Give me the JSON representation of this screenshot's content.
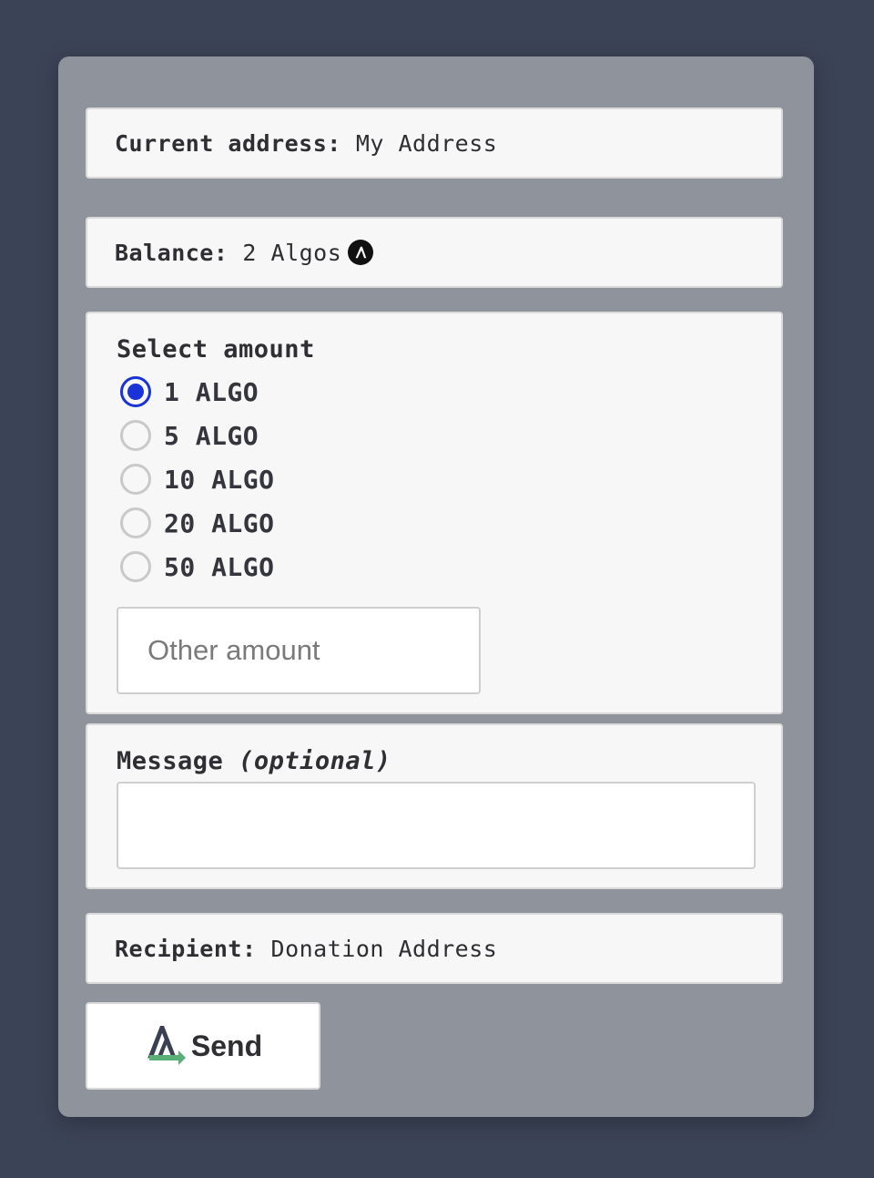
{
  "address": {
    "label": "Current address:",
    "value": "My Address"
  },
  "balance": {
    "label": "Balance:",
    "value": "2 Algos",
    "icon": "algo-coin-icon"
  },
  "amount": {
    "label": "Select amount",
    "options": [
      "1 ALGO",
      "5 ALGO",
      "10 ALGO",
      "20 ALGO",
      "50 ALGO"
    ],
    "selected_index": 0,
    "other_placeholder": "Other amount",
    "other_value": ""
  },
  "message": {
    "label": "Message",
    "label_hint": "(optional)",
    "value": ""
  },
  "recipient": {
    "label": "Recipient:",
    "value": "Donation Address"
  },
  "send": {
    "label": "Send",
    "icon": "algo-send-icon"
  },
  "colors": {
    "page_bg": "#3b4356",
    "card_bg": "#8f939c",
    "radio_accent": "#1a33d6",
    "send_arrow": "#5aae78"
  }
}
